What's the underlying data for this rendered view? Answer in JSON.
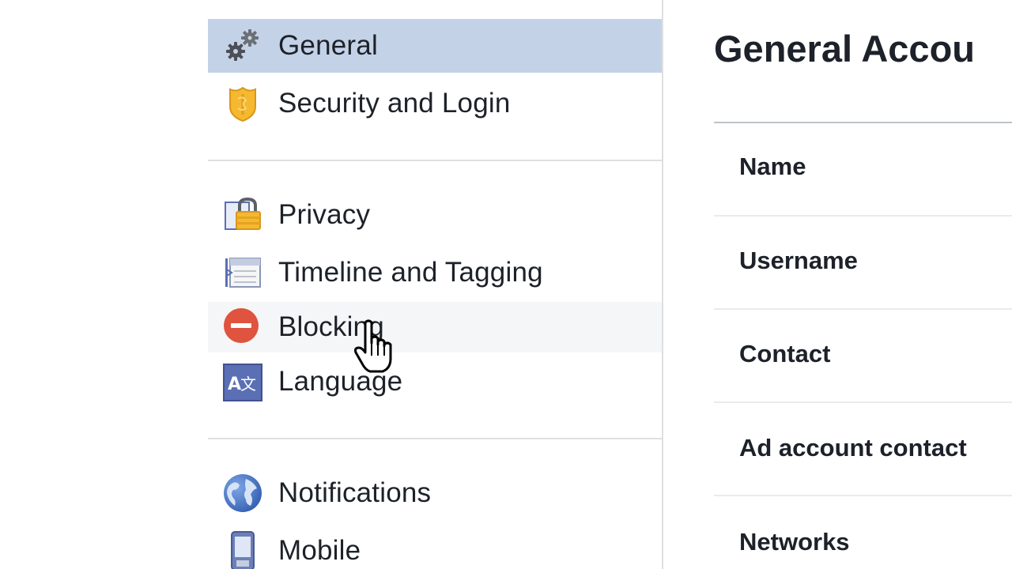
{
  "sidebar": {
    "items": [
      {
        "label": "General",
        "icon": "gears-icon",
        "selected": true
      },
      {
        "label": "Security and Login",
        "icon": "shield-badge-icon"
      },
      {
        "label": "Privacy",
        "icon": "privacy-lock-icon"
      },
      {
        "label": "Timeline and Tagging",
        "icon": "timeline-icon"
      },
      {
        "label": "Blocking",
        "icon": "blocking-icon",
        "hovered": true
      },
      {
        "label": "Language",
        "icon": "language-icon"
      },
      {
        "label": "Notifications",
        "icon": "globe-icon"
      },
      {
        "label": "Mobile",
        "icon": "mobile-phone-icon"
      }
    ]
  },
  "main": {
    "title": "General Accou",
    "rows": [
      {
        "label": "Name"
      },
      {
        "label": "Username"
      },
      {
        "label": "Contact"
      },
      {
        "label": "Ad account contact"
      },
      {
        "label": "Networks"
      }
    ]
  },
  "colors": {
    "selected_bg": "#c4d2e7",
    "text": "#1d2129",
    "divider": "#dddfe2",
    "blocking_red": "#e0533f",
    "shield_gold": "#f5b82e",
    "language_blue": "#5b6fb5",
    "globe_blue": "#4a78c9"
  }
}
